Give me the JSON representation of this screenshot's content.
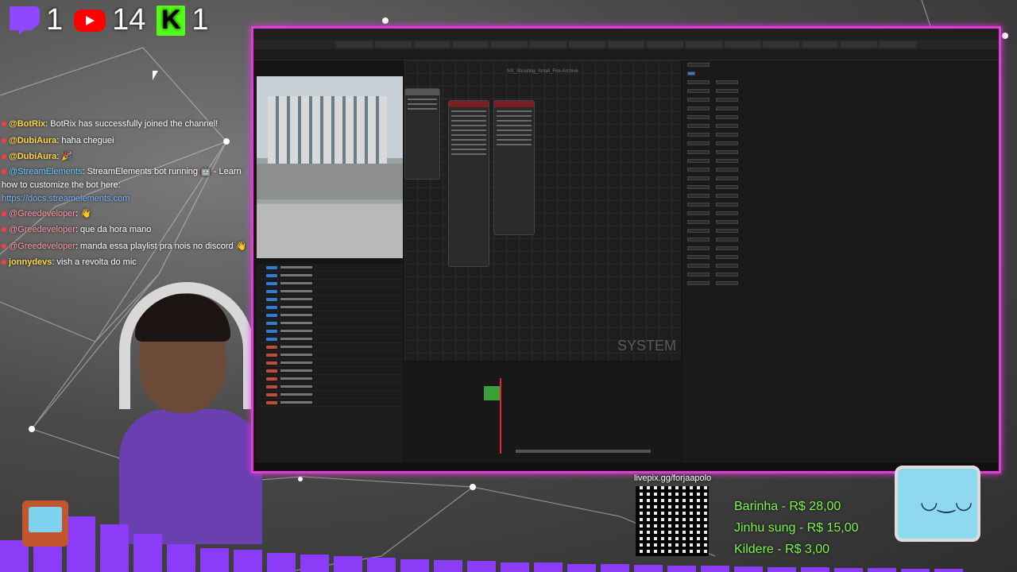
{
  "stats": [
    {
      "platform": "twitch-icon",
      "count": "1"
    },
    {
      "platform": "youtube-icon",
      "count": "14"
    },
    {
      "platform": "kick-icon",
      "letter": "K",
      "count": "1"
    }
  ],
  "chat": [
    {
      "user": "@BotRix",
      "text": ": BotRix has successfully joined the channel!",
      "color": "#ffd84a"
    },
    {
      "user": "@DubiAura",
      "text": ": haha cheguei",
      "color": "#ffd84a"
    },
    {
      "user": "@DubiAura",
      "text": ": 🎉",
      "color": "#ffd84a"
    },
    {
      "user": "@StreamElements",
      "text": ": StreamElements bot running 🤖 - Learn how to customize the bot here:",
      "link": "https://docs.streamelements.com",
      "color": "#5ad2ff"
    },
    {
      "user": "@Greedeveloper",
      "text": ": 👋",
      "color": "#ff9aa6"
    },
    {
      "user": "@Greedeveloper",
      "text": ": que da hora mano",
      "color": "#ff9aa6"
    },
    {
      "user": "@Greedeveloper",
      "text": ": manda essa playlist pra nois no discord 👋",
      "color": "#ff9aa6"
    },
    {
      "user": "jonnydevs",
      "text": ": vish a revolta do mic",
      "color": "#ffd84a"
    }
  ],
  "editor": {
    "graph_title": "NS_Shooting_Small_Fire-Archive",
    "watermark": "SYSTEM"
  },
  "qr": {
    "label": "livepix.gg/forjaapolo"
  },
  "donations": [
    "Barinha - R$ 28,00",
    "Jinhu sung - R$ 15,00",
    "Kildere - R$ 3,00"
  ],
  "colors": {
    "accent": "#e23bd8",
    "viz": "#8b3cf7",
    "donation": "#7bf54a"
  }
}
